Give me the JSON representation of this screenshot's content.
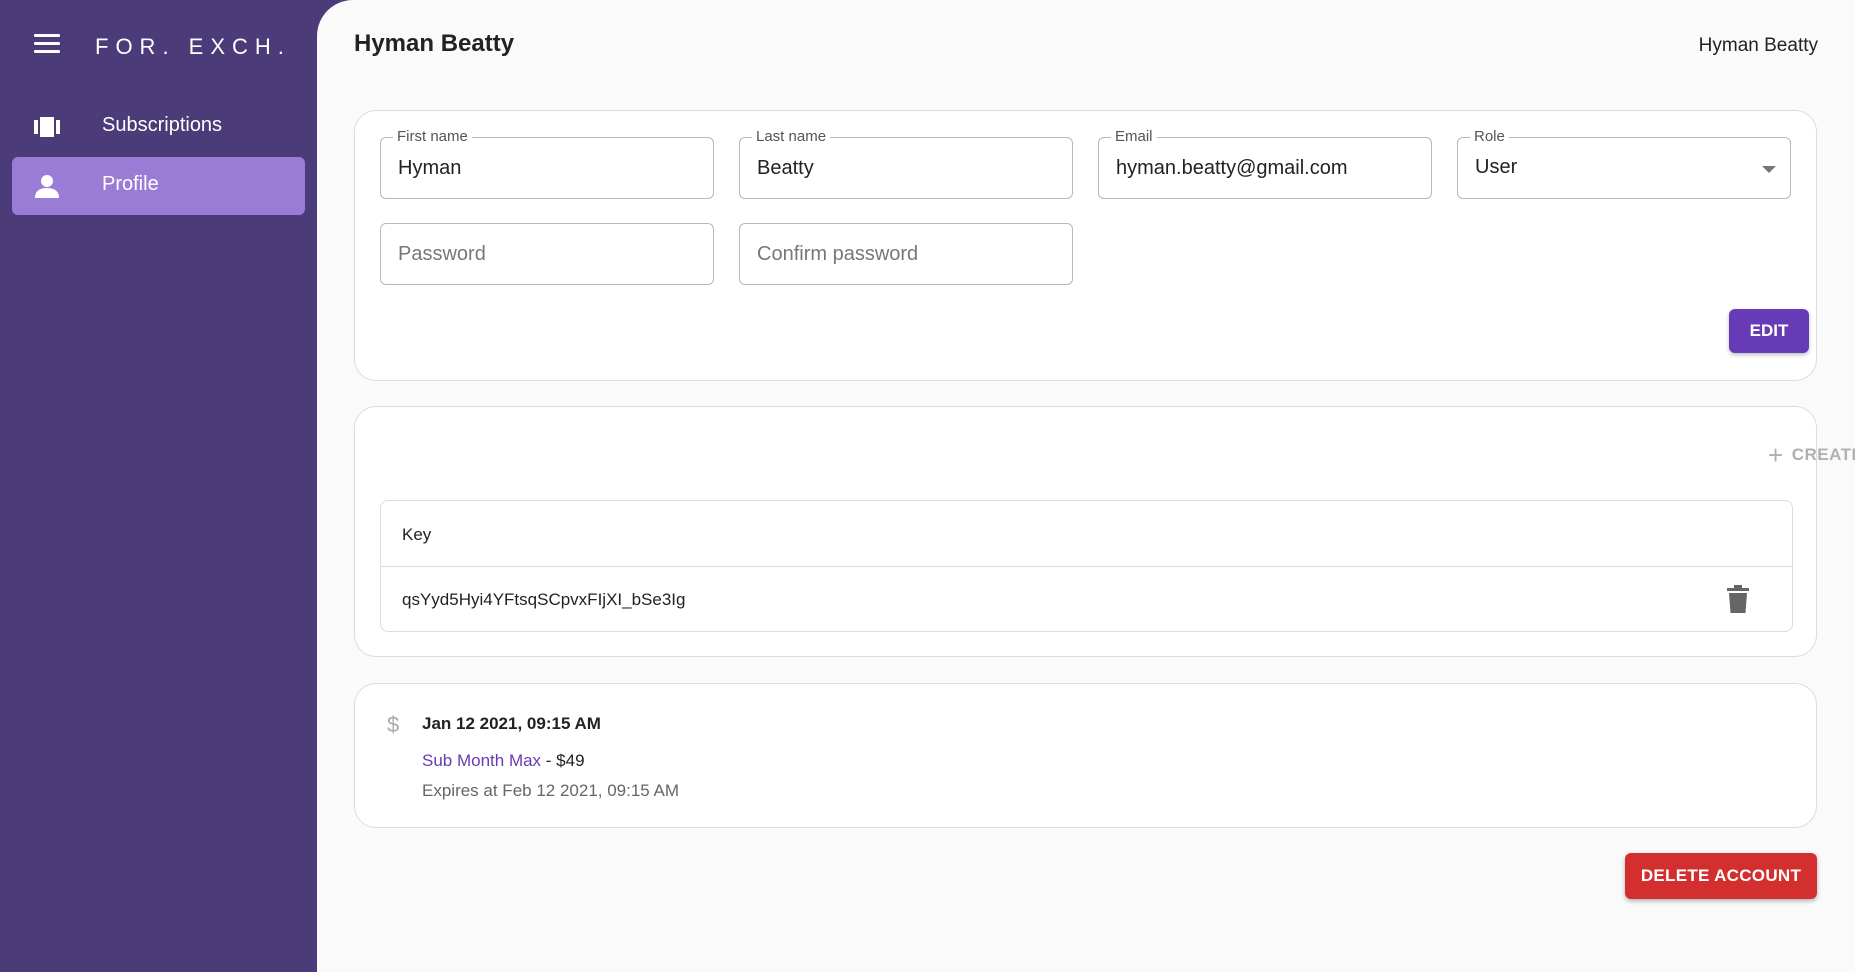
{
  "brand": "FOR. EXCH.",
  "sidebar": {
    "items": [
      {
        "label": "Subscriptions",
        "icon": "subscriptions-icon",
        "active": false
      },
      {
        "label": "Profile",
        "icon": "person-icon",
        "active": true
      }
    ]
  },
  "header": {
    "title": "Hyman Beatty",
    "user_name": "Hyman Beatty"
  },
  "profile_form": {
    "first_name": {
      "label": "First name",
      "value": "Hyman"
    },
    "last_name": {
      "label": "Last name",
      "value": "Beatty"
    },
    "email": {
      "label": "Email",
      "value": "hyman.beatty@gmail.com"
    },
    "role": {
      "label": "Role",
      "value": "User"
    },
    "password": {
      "placeholder": "Password",
      "value": ""
    },
    "confirm_password": {
      "placeholder": "Confirm password",
      "value": ""
    },
    "edit_label": "EDIT"
  },
  "keys": {
    "create_label": "CREATE",
    "column_header": "Key",
    "rows": [
      {
        "key": "qsYyd5Hyi4YFtsqSCpvxFIjXI_bSe3Ig"
      }
    ]
  },
  "subscriptions": [
    {
      "date": "Jan 12 2021, 09:15 AM",
      "plan": "Sub Month Max",
      "separator": " - ",
      "price": "$49",
      "expires": "Expires at Feb 12 2021, 09:15 AM"
    }
  ],
  "delete_account_label": "DELETE ACCOUNT",
  "colors": {
    "sidebar_bg": "#4b3b78",
    "active_item": "#9a7bd6",
    "primary": "#673ab7",
    "danger": "#d32f2f"
  }
}
